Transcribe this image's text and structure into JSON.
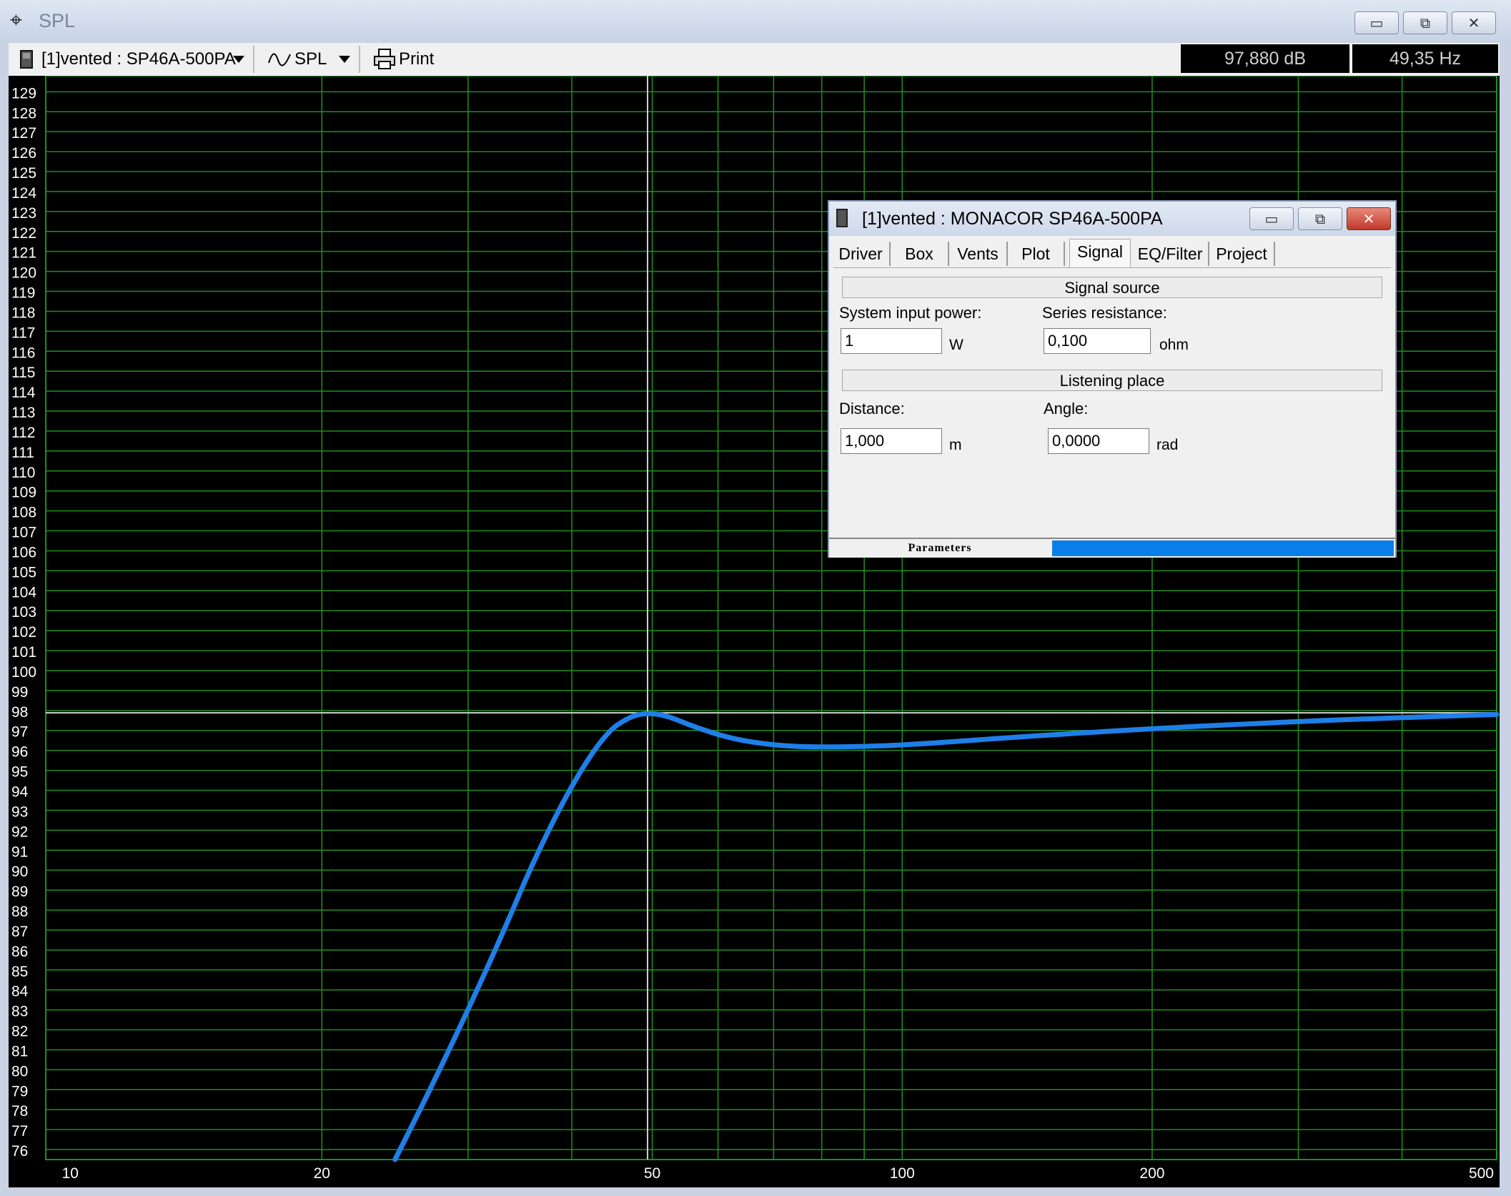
{
  "window": {
    "title": "SPL",
    "minimize_glyph": "▭",
    "maximize_glyph": "⧉",
    "close_glyph": "✕"
  },
  "toolbar": {
    "project_label": "[1]vented : SP46A-500PA",
    "view_label": "SPL",
    "print_label": "Print",
    "readout_level": "97,880 dB",
    "readout_freq": "49,35 Hz"
  },
  "icons": {
    "app": "crosshair-icon",
    "project": "speaker-box-icon",
    "view": "waveform-icon",
    "print": "printer-icon"
  },
  "colors": {
    "plot_bg": "#000000",
    "grid": "#1f8f1f",
    "curve": "#1e7fe8",
    "cursor": "#d0d0d0",
    "accent": "#0a7ee8"
  },
  "chart_data": {
    "type": "line",
    "xscale": "log",
    "xlim": [
      9.3,
      520
    ],
    "ylim": [
      75.5,
      129.8
    ],
    "x_ticks": [
      10,
      20,
      50,
      100,
      200,
      500
    ],
    "x_tick_labels": [
      "10",
      "20",
      "50",
      "100",
      "200",
      "500"
    ],
    "x_grid": [
      20,
      30,
      40,
      50,
      60,
      70,
      80,
      90,
      100,
      200,
      300,
      400
    ],
    "y_ticks": [
      76,
      77,
      78,
      79,
      80,
      81,
      82,
      83,
      84,
      85,
      86,
      87,
      88,
      89,
      90,
      91,
      92,
      93,
      94,
      95,
      96,
      97,
      98,
      99,
      100,
      101,
      102,
      103,
      104,
      105,
      106,
      107,
      108,
      109,
      110,
      111,
      112,
      113,
      114,
      115,
      116,
      117,
      118,
      119,
      120,
      121,
      122,
      123,
      124,
      125,
      126,
      127,
      128,
      129
    ],
    "cursor": {
      "x": 49.35,
      "y": 97.88
    },
    "series": [
      {
        "points": [
          [
            24.5,
            75.5
          ],
          [
            27,
            79
          ],
          [
            30,
            83
          ],
          [
            33,
            86.8
          ],
          [
            36,
            90.5
          ],
          [
            40,
            94.3
          ],
          [
            44,
            96.9
          ],
          [
            47,
            97.7
          ],
          [
            49.35,
            97.88
          ],
          [
            52,
            97.75
          ],
          [
            56,
            97.2
          ],
          [
            62,
            96.6
          ],
          [
            70,
            96.25
          ],
          [
            80,
            96.15
          ],
          [
            100,
            96.25
          ],
          [
            130,
            96.6
          ],
          [
            200,
            97.1
          ],
          [
            300,
            97.45
          ],
          [
            400,
            97.65
          ],
          [
            520,
            97.8
          ]
        ]
      }
    ]
  },
  "dialog": {
    "title": "[1]vented : MONACOR SP46A-500PA",
    "tabs": [
      "Driver",
      "Box",
      "Vents",
      "Plot",
      "Signal",
      "EQ/Filter",
      "Project"
    ],
    "active_tab": "Signal",
    "signal_source_header": "Signal source",
    "power_label": "System input power:",
    "power_value": "1",
    "power_unit": "W",
    "resistance_label": "Series resistance:",
    "resistance_value": "0,100",
    "resistance_unit": "ohm",
    "listening_header": "Listening place",
    "distance_label": "Distance:",
    "distance_value": "1,000",
    "distance_unit": "m",
    "angle_label": "Angle:",
    "angle_value": "0,0000",
    "angle_unit": "rad",
    "status_caption": "Parameters"
  }
}
